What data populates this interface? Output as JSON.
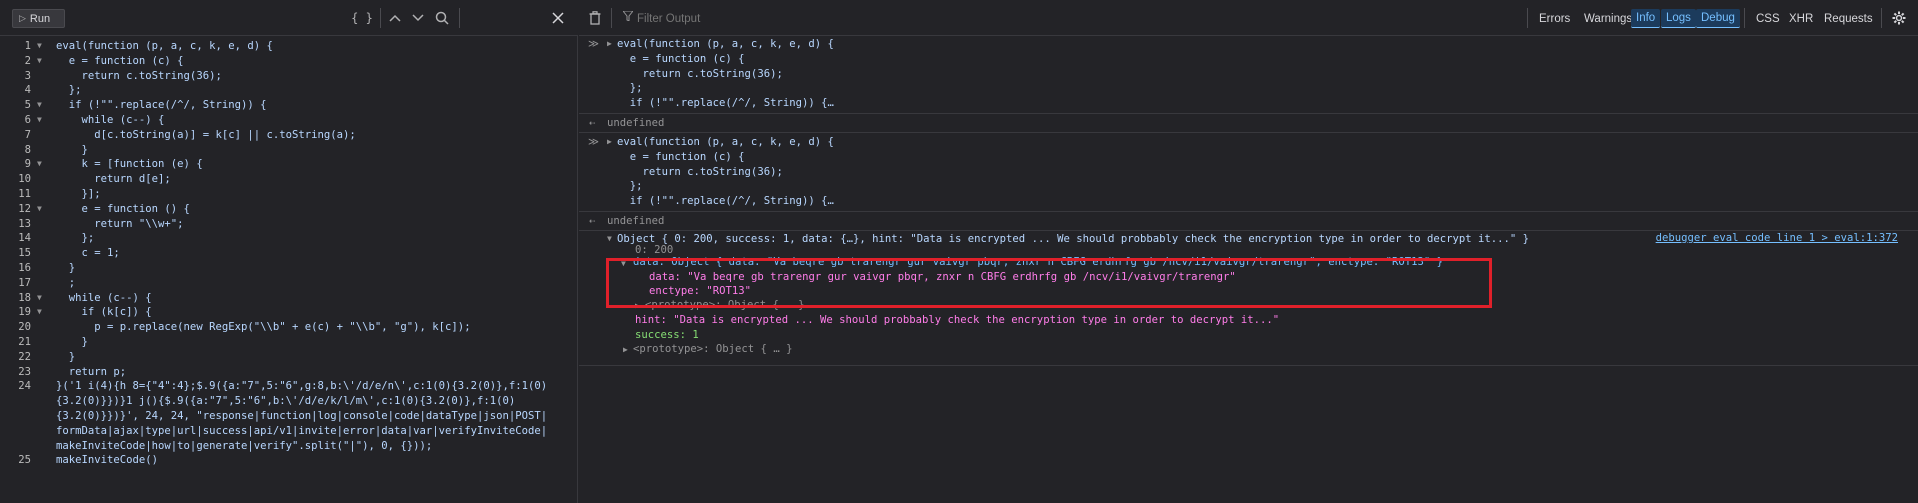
{
  "left_toolbar": {
    "run_label": "Run",
    "pretty_print_label": "{ }"
  },
  "editor": {
    "lines": [
      {
        "n": "1",
        "fold": "▼",
        "text": "eval(function (p, a, c, k, e, d) {"
      },
      {
        "n": "2",
        "fold": "▼",
        "text": "  e = function (c) {"
      },
      {
        "n": "3",
        "fold": "",
        "text": "    return c.toString(36);"
      },
      {
        "n": "4",
        "fold": "",
        "text": "  };"
      },
      {
        "n": "5",
        "fold": "▼",
        "text": "  if (!\"\".replace(/^/, String)) {"
      },
      {
        "n": "6",
        "fold": "▼",
        "text": "    while (c--) {"
      },
      {
        "n": "7",
        "fold": "",
        "text": "      d[c.toString(a)] = k[c] || c.toString(a);"
      },
      {
        "n": "8",
        "fold": "",
        "text": "    }"
      },
      {
        "n": "9",
        "fold": "▼",
        "text": "    k = [function (e) {"
      },
      {
        "n": "10",
        "fold": "",
        "text": "      return d[e];"
      },
      {
        "n": "11",
        "fold": "",
        "text": "    }];"
      },
      {
        "n": "12",
        "fold": "▼",
        "text": "    e = function () {"
      },
      {
        "n": "13",
        "fold": "",
        "text": "      return \"\\\\w+\";"
      },
      {
        "n": "14",
        "fold": "",
        "text": "    };"
      },
      {
        "n": "15",
        "fold": "",
        "text": "    c = 1;"
      },
      {
        "n": "16",
        "fold": "",
        "text": "  }"
      },
      {
        "n": "17",
        "fold": "",
        "text": "  ;"
      },
      {
        "n": "18",
        "fold": "▼",
        "text": "  while (c--) {"
      },
      {
        "n": "19",
        "fold": "▼",
        "text": "    if (k[c]) {"
      },
      {
        "n": "20",
        "fold": "",
        "text": "      p = p.replace(new RegExp(\"\\\\b\" + e(c) + \"\\\\b\", \"g\"), k[c]);"
      },
      {
        "n": "21",
        "fold": "",
        "text": "    }"
      },
      {
        "n": "22",
        "fold": "",
        "text": "  }"
      },
      {
        "n": "23",
        "fold": "",
        "text": "  return p;"
      },
      {
        "n": "24",
        "fold": "",
        "text": "}('1 i(4){h 8={\"4\":4};$.9({a:\"7\",5:\"6\",g:8,b:\\'/d/e/n\\',c:1(0){3.2(0)},f:1(0)"
      },
      {
        "n": "",
        "fold": "",
        "text": "{3.2(0)}})}1 j(){$.9({a:\"7\",5:\"6\",b:\\'/d/e/k/l/m\\',c:1(0){3.2(0)},f:1(0)"
      },
      {
        "n": "",
        "fold": "",
        "text": "{3.2(0)}})}', 24, 24, \"response|function|log|console|code|dataType|json|POST|"
      },
      {
        "n": "",
        "fold": "",
        "text": "formData|ajax|type|url|success|api/v1|invite|error|data|var|verifyInviteCode|"
      },
      {
        "n": "",
        "fold": "",
        "text": "makeInviteCode|how|to|generate|verify\".split(\"|\"), 0, {}));"
      },
      {
        "n": "25",
        "fold": "",
        "text": "makeInviteCode()"
      }
    ]
  },
  "right_toolbar": {
    "filter_placeholder": "Filter Output",
    "filters": [
      {
        "label": "Errors",
        "checked": false
      },
      {
        "label": "Warnings",
        "checked": false
      },
      {
        "label": "Info",
        "checked": true
      },
      {
        "label": "Logs",
        "checked": true
      },
      {
        "label": "Debug",
        "checked": true
      }
    ],
    "types": [
      "CSS",
      "XHR",
      "Requests"
    ]
  },
  "console": {
    "input_1": [
      "eval(function (p, a, c, k, e, d) {",
      "  e = function (c) {",
      "    return c.toString(36);",
      "  };",
      "  if (!\"\".replace(/^/, String)) {…"
    ],
    "result_1": "undefined",
    "input_2": [
      "eval(function (p, a, c, k, e, d) {",
      "  e = function (c) {",
      "    return c.toString(36);",
      "  };",
      "  if (!\"\".replace(/^/, String)) {…"
    ],
    "result_2": "undefined",
    "object_summary": "Object { 0: 200, success: 1, data: {…}, hint: \"Data is encrypted ... We should probbably check the encryption type in order to decrypt it...\" }",
    "location": "debugger eval code line 1 > eval:1:372",
    "prop_0": "0: 200",
    "data_summary": "data: Object { data: \"Va beqre gb trarengr gur vaivgr pbqr, znxr n CBFG erdhrfg gb /ncv/i1/vaivgr/trarengr\", enctype: \"ROT13\" }",
    "data_data": "data: \"Va beqre gb trarengr gur vaivgr pbqr, znxr n CBFG erdhrfg gb /ncv/i1/vaivgr/trarengr\"",
    "data_enctype": "enctype: \"ROT13\"",
    "data_prototype": "<prototype>: Object { … }",
    "hint": "hint: \"Data is encrypted ... We should probbably check the encryption type in order to decrypt it...\"",
    "success": "success: 1",
    "prototype": "<prototype>: Object { … }"
  },
  "colors": {
    "background": "#232327",
    "highlight": "#e0202a",
    "accent": "#75bfff"
  }
}
